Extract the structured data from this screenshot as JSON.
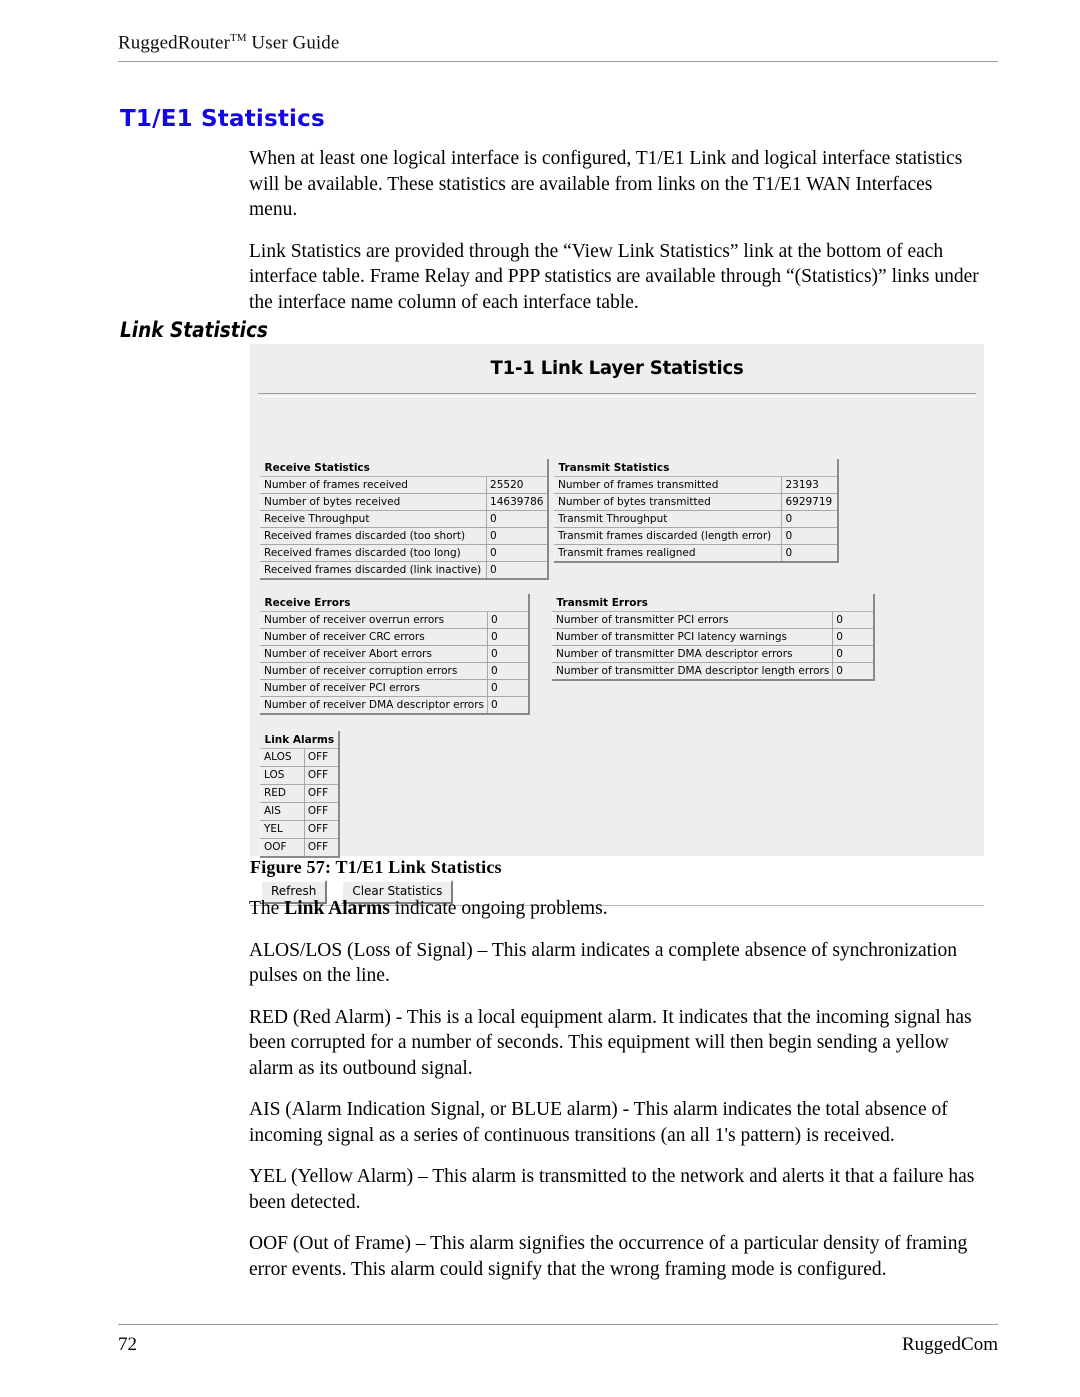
{
  "header": {
    "title_main": "RuggedRouter",
    "title_sup": "TM",
    "title_rest": " User Guide"
  },
  "section": {
    "title": "T1/E1 Statistics",
    "title_color": "#1106e8",
    "sub_heading": "Link Statistics"
  },
  "intro_paragraphs": [
    "When at least one logical interface is configured, T1/E1 Link and logical interface statistics will be available.  These statistics are available from links on the T1/E1 WAN Interfaces menu.",
    "Link Statistics are provided through the “View Link Statistics” link at the bottom of each interface table.  Frame Relay and PPP statistics are available through “(Statistics)” links under the interface name column of each interface table."
  ],
  "screenshot": {
    "title": "T1-1 Link Layer Statistics",
    "receive_statistics": {
      "caption": "Receive Statistics",
      "rows": [
        {
          "label": "Number of frames received",
          "value": "25520"
        },
        {
          "label": "Number of bytes received",
          "value": "14639786"
        },
        {
          "label": "Receive Throughput",
          "value": "0"
        },
        {
          "label": "Received frames discarded (too short)",
          "value": "0"
        },
        {
          "label": "Received frames discarded (too long)",
          "value": "0"
        },
        {
          "label": "Received frames discarded (link inactive)",
          "value": "0"
        }
      ]
    },
    "transmit_statistics": {
      "caption": "Transmit Statistics",
      "rows": [
        {
          "label": "Number of frames transmitted",
          "value": "23193"
        },
        {
          "label": "Number of bytes transmitted",
          "value": "6929719"
        },
        {
          "label": "Transmit Throughput",
          "value": "0"
        },
        {
          "label": "Transmit frames discarded (length error)",
          "value": "0"
        },
        {
          "label": "Transmit frames realigned",
          "value": "0"
        }
      ]
    },
    "receive_errors": {
      "caption": "Receive Errors",
      "rows": [
        {
          "label": "Number of receiver overrun errors",
          "value": "0"
        },
        {
          "label": "Number of receiver CRC errors",
          "value": "0"
        },
        {
          "label": "Number of receiver Abort errors",
          "value": "0"
        },
        {
          "label": "Number of receiver corruption errors",
          "value": "0"
        },
        {
          "label": "Number of receiver PCI errors",
          "value": "0"
        },
        {
          "label": "Number of receiver DMA descriptor errors",
          "value": "0"
        }
      ]
    },
    "transmit_errors": {
      "caption": "Transmit Errors",
      "rows": [
        {
          "label": "Number of transmitter PCI errors",
          "value": "0"
        },
        {
          "label": "Number of transmitter PCI latency warnings",
          "value": "0"
        },
        {
          "label": "Number of transmitter DMA descriptor errors",
          "value": "0"
        },
        {
          "label": "Number of transmitter DMA descriptor length errors",
          "value": "0"
        }
      ]
    },
    "link_alarms": {
      "caption": "Link Alarms",
      "rows": [
        {
          "label": "ALOS",
          "value": "OFF"
        },
        {
          "label": "LOS",
          "value": "OFF"
        },
        {
          "label": "RED",
          "value": "OFF"
        },
        {
          "label": "AIS",
          "value": "OFF"
        },
        {
          "label": "YEL",
          "value": "OFF"
        },
        {
          "label": "OOF",
          "value": "OFF"
        }
      ]
    },
    "buttons": {
      "refresh": "Refresh",
      "clear": "Clear Statistics"
    }
  },
  "figure": {
    "caption": "Figure 57: T1/E1 Link Statistics"
  },
  "alarm_paragraphs": {
    "intro_lead": "The ",
    "intro_bold": "Link Alarms",
    "intro_tail": " indicate ongoing problems.",
    "items": [
      "ALOS/LOS (Loss of Signal) – This alarm indicates a complete absence of synchronization pulses on the line.",
      "RED (Red Alarm) - This is a local equipment alarm. It indicates that the incoming signal has been corrupted for a number of seconds.  This equipment will then begin sending a yellow alarm as its outbound signal.",
      "AIS (Alarm Indication Signal, or BLUE alarm) - This alarm indicates the total absence of incoming signal as a series of continuous transitions (an all 1's pattern) is received.",
      "YEL (Yellow Alarm) – This alarm is transmitted to the network and alerts it that a failure has been detected.",
      "OOF (Out of Frame) – This alarm signifies the occurrence of a particular density of framing error events.  This alarm could signify that the wrong framing mode is configured."
    ]
  },
  "footer": {
    "page_number": "72",
    "company": "RuggedCom"
  }
}
